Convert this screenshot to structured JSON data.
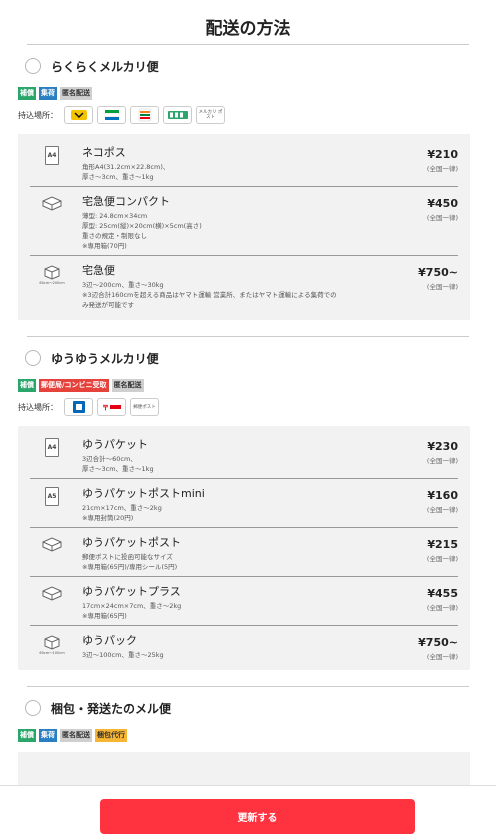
{
  "title": "配送の方法",
  "update_button": "更新する",
  "methods": [
    {
      "name": "らくらくメルカリ便",
      "tags": [
        "補償",
        "集荷",
        "匿名配送"
      ],
      "carriers_label": "持込場所：",
      "carriers": [
        "ヤマト",
        "ファミマ",
        "セブン",
        "PUDO",
        "メルカリ ポスト"
      ],
      "options": [
        {
          "name": "ネコポス",
          "desc": "角形A4(31.2cm×22.8cm)、\n厚さ〜3cm、重さ〜1kg",
          "price": "¥210",
          "note": "(全国一律)",
          "icon": "A4"
        },
        {
          "name": "宅急便コンパクト",
          "desc": "薄型: 24.8cm×34cm\n厚型: 25cm(縦)×20cm(横)×5cm(高さ)\n重さの規定・制限なし\n※専用箱(70円)",
          "price": "¥450",
          "note": "(全国一律)",
          "icon": "box"
        },
        {
          "name": "宅急便",
          "desc": "3辺〜200cm、重さ〜30kg\n※3辺合計160cmを超える商品はヤマト運輸 営業所、またはヤマト運輸による集荷での\nみ発送が可能です",
          "price": "¥750~",
          "note": "(全国一律)",
          "icon": "box-large",
          "dim": "60cm〜200cm"
        }
      ]
    },
    {
      "name": "ゆうゆうメルカリ便",
      "tags": [
        "補償",
        "郵便局/コンビニ受取",
        "匿名配送"
      ],
      "carriers_label": "持込場所：",
      "carriers": [
        "ローソン",
        "郵便局",
        "郵便ポスト"
      ],
      "options": [
        {
          "name": "ゆうパケット",
          "desc": "3辺合計〜60cm、\n厚さ〜3cm、重さ〜1kg",
          "price": "¥230",
          "note": "(全国一律)",
          "icon": "A4"
        },
        {
          "name": "ゆうパケットポストmini",
          "desc": "21cm×17cm、重さ〜2kg\n※専用封筒(20円)",
          "price": "¥160",
          "note": "(全国一律)",
          "icon": "A5"
        },
        {
          "name": "ゆうパケットポスト",
          "desc": "郵便ポストに投函可能なサイズ\n※専用箱(65円)/専用シール(5円)",
          "price": "¥215",
          "note": "(全国一律)",
          "icon": "box"
        },
        {
          "name": "ゆうパケットプラス",
          "desc": "17cm×24cm×7cm、重さ〜2kg\n※専用箱(65円)",
          "price": "¥455",
          "note": "(全国一律)",
          "icon": "box"
        },
        {
          "name": "ゆうパック",
          "desc": "3辺〜100cm、重さ〜25kg",
          "price": "¥750~",
          "note": "(全国一律)",
          "icon": "box-large",
          "dim": "60cm〜100cm"
        }
      ]
    },
    {
      "name": "梱包・発送たのメル便",
      "tags": [
        "補償",
        "集荷",
        "匿名配送",
        "梱包代行"
      ]
    }
  ],
  "colors": {
    "accent": "#ff333f",
    "tag_green": "#2aa66b",
    "tag_blue": "#2a7ec2",
    "tag_red": "#e6423c",
    "tag_yellow": "#f6b533"
  }
}
